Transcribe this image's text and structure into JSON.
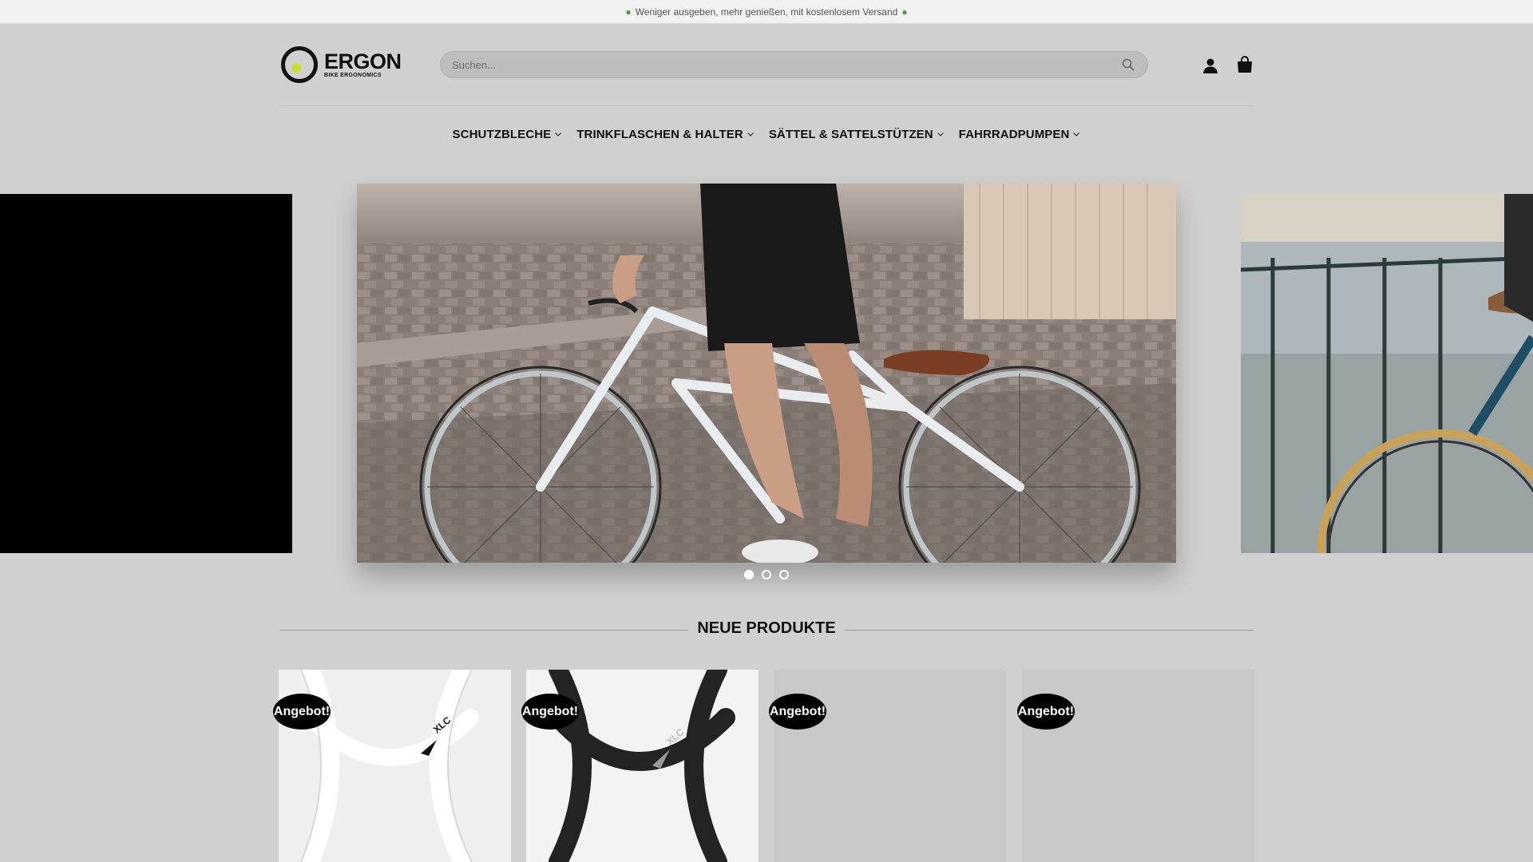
{
  "promo": {
    "icon_left": "money-icon",
    "text": "Weniger ausgeben, mehr genießen, mit kostenlosem Versand",
    "icon_right": "money-icon"
  },
  "header": {
    "logo_word": "ERGON",
    "logo_sub": "BIKE ERGONOMICS",
    "search_placeholder": "Suchen...",
    "icons": [
      "search-icon",
      "user-icon",
      "cart-icon"
    ]
  },
  "nav": {
    "items": [
      {
        "label": "SCHUTZBLECHE"
      },
      {
        "label": "TRINKFLASCHEN & HALTER"
      },
      {
        "label": "SÄTTEL & SATTELSTÜTZEN"
      },
      {
        "label": "FAHRRADPUMPEN"
      }
    ]
  },
  "slider": {
    "slide_count": 3,
    "active_index": 0
  },
  "section": {
    "title": "NEUE PRODUKTE"
  },
  "products": [
    {
      "badge": "Angebot!",
      "image": "white-bottle-cage"
    },
    {
      "badge": "Angebot!",
      "image": "black-bottle-cage"
    },
    {
      "badge": "Angebot!",
      "image": "placeholder"
    },
    {
      "badge": "Angebot!",
      "image": "placeholder"
    }
  ],
  "colors": {
    "page_bg": "#d0d0d0",
    "topbar_bg": "#f2f2f2",
    "accent_logo": "#cddc29",
    "badge_bg": "#000000"
  }
}
